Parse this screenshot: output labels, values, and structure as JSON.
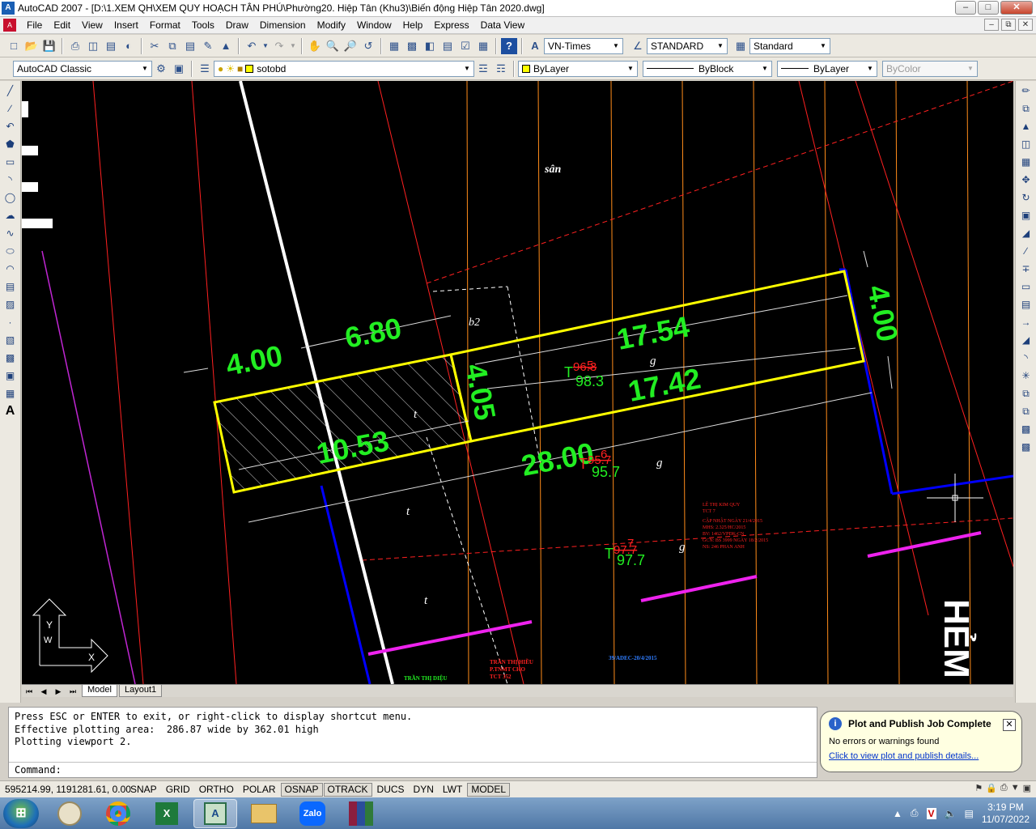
{
  "window": {
    "title": "AutoCAD 2007 - [D:\\1.XEM QH\\XEM QUY HOẠCH TÂN PHÚ\\Phường20. Hiệp Tân (Khu3)\\Biến động Hiệp Tân 2020.dwg]",
    "app_icon": "autocad-icon",
    "buttons": [
      "minimize",
      "maximize",
      "close"
    ]
  },
  "menubar": {
    "items": [
      "File",
      "Edit",
      "View",
      "Insert",
      "Format",
      "Tools",
      "Draw",
      "Dimension",
      "Modify",
      "Window",
      "Help",
      "Express",
      "Data View"
    ]
  },
  "toolbar1": {
    "text_style": "VN-Times",
    "dim_style": "STANDARD",
    "table_style": "Standard"
  },
  "toolbar2": {
    "workspace": "AutoCAD Classic",
    "layer": "sotobd",
    "color": "ByLayer",
    "linetype": "ByBlock",
    "lineweight": "ByLayer",
    "plotstyle": "ByColor",
    "color_swatch": "#ffff00"
  },
  "drawing": {
    "background": "#000000",
    "dimensions": {
      "d_400_left": "4.00",
      "d_680": "6.80",
      "d_1754": "17.54",
      "d_400_right": "4.00",
      "d_405": "4.05",
      "d_1742": "17.42",
      "d_1053": "10.53",
      "d_2800": "28.00"
    },
    "labels": {
      "san": "sân",
      "b2": "b2",
      "g1": "g",
      "g2": "g",
      "g3": "g",
      "t1": "t",
      "t2": "t",
      "t3": "t",
      "hem": "HẺM"
    },
    "parcels": [
      {
        "prefix": "T",
        "old": "96.3",
        "num": "5",
        "area": "98.3"
      },
      {
        "prefix": "T",
        "old": "95.7",
        "num": "6",
        "area": "95.7"
      },
      {
        "prefix": "T",
        "old": "97.7",
        "num": "7",
        "area": "97.7"
      }
    ],
    "red_notes": [
      "LÊ THỊ KIM QUY",
      "TCT 7",
      "CẬP NHẬT NGÀY 21/4/2015",
      "MHS: 2.325/HC/2015",
      "BV: 1462/VPĐK-CN",
      "GCN: BS 3999 NGÀY 18/2/2015",
      "NS: 246 PHAN ANH"
    ],
    "bottom_notes": {
      "tran_1": "TRẦN THỊ HIỀU",
      "tran_2": "P.TNMT CHO",
      "tran_3": "TCT 352",
      "adec": "39/ADEC-20/4/2015",
      "tran_bottom": "TRẦN THỊ DIỆU"
    },
    "ucs": {
      "x": "X",
      "y": "Y",
      "w": "W"
    },
    "colors": {
      "dimension_text": "#22ee22",
      "parcel_outline": "#ffff00",
      "boundary_blue": "#0000ff",
      "road_magenta": "#ee22ee",
      "grid_orange": "#ff8c1a",
      "red": "#ff2020"
    }
  },
  "tabs": [
    "Model",
    "Layout1"
  ],
  "command": {
    "lines": [
      "Press ESC or ENTER to exit, or right-click to display shortcut menu.",
      "Effective plotting area:  286.87 wide by 362.01 high",
      "Plotting viewport 2."
    ],
    "prompt": "Command:"
  },
  "notification": {
    "title": "Plot and Publish Job Complete",
    "message": "No errors or warnings found",
    "link": "Click to view plot and publish details..."
  },
  "statusbar": {
    "coords": "595214.99, 1191281.61, 0.00",
    "toggles": [
      {
        "label": "SNAP",
        "on": false
      },
      {
        "label": "GRID",
        "on": false
      },
      {
        "label": "ORTHO",
        "on": false
      },
      {
        "label": "POLAR",
        "on": false
      },
      {
        "label": "OSNAP",
        "on": true
      },
      {
        "label": "OTRACK",
        "on": true
      },
      {
        "label": "DUCS",
        "on": false
      },
      {
        "label": "DYN",
        "on": false
      },
      {
        "label": "LWT",
        "on": false
      },
      {
        "label": "MODEL",
        "on": true
      }
    ]
  },
  "taskbar": {
    "apps": [
      "start-icon",
      "file-manager-icon",
      "chrome-icon",
      "excel-icon",
      "autocad-icon",
      "explorer-icon",
      "zalo-icon",
      "winrar-icon"
    ],
    "zalo_label": "Zalo",
    "time": "3:19 PM",
    "date": "11/07/2022"
  }
}
